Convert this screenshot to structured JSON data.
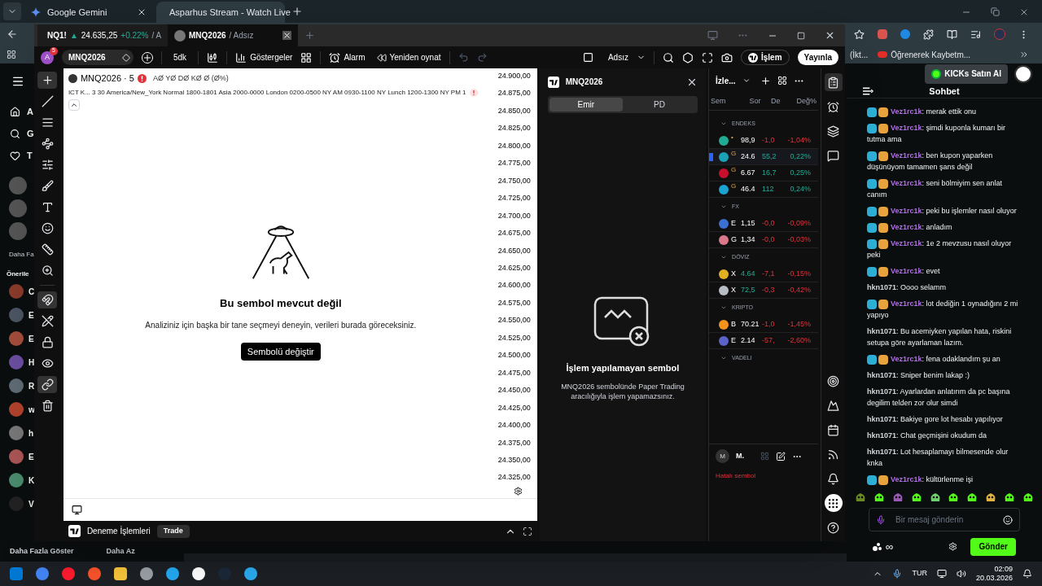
{
  "browser": {
    "tabs": [
      {
        "title": "Google Gemini",
        "selected": false
      },
      {
        "title": "Asparhus Stream - Watch Live",
        "selected": true
      }
    ],
    "bookmarks": [
      "(İkt...",
      "Öğrenerek Kaybetm..."
    ]
  },
  "site_sidebar": {
    "nav": [
      "A",
      "G",
      "T"
    ],
    "more": "Daha Fa",
    "heading": "Önerile",
    "channels": [
      "C",
      "E",
      "E",
      "H",
      "R",
      "w",
      "h",
      "E",
      "K",
      "V"
    ],
    "show_more": "Daha Fazla Göster",
    "show_less": "Daha Az"
  },
  "trading_window": {
    "tabs": [
      {
        "symbol": "NQ1!",
        "arrow": "▲",
        "price": "24.635,25",
        "change": "+0.22%",
        "layout": "/ A",
        "selected": false
      },
      {
        "symbol": "MNQ2026",
        "layout": "/ Adsız",
        "selected": true
      }
    ],
    "toolbar": {
      "avatar": "A",
      "badge": "5",
      "symbol": "MNQ2026",
      "interval": "5dk",
      "indicators": "Göstergeler",
      "alert": "Alarm",
      "replay": "Yeniden oynat",
      "layout_name": "Adsız",
      "trade": "İşlem",
      "publish": "Yayınla"
    },
    "tools": [
      {
        "kind": "crosshair",
        "selected": true
      },
      {
        "kind": "line",
        "selected": false
      },
      {
        "kind": "fib",
        "selected": false
      },
      {
        "kind": "pattern",
        "selected": false
      },
      {
        "kind": "projection",
        "selected": false
      },
      {
        "kind": "brush",
        "selected": false
      },
      {
        "kind": "text",
        "selected": false
      },
      {
        "kind": "emoji",
        "selected": false
      },
      {
        "kind": "ruler",
        "selected": false
      },
      {
        "kind": "zoom",
        "selected": false
      },
      {
        "kind": "magnet",
        "selected": true
      },
      {
        "kind": "pencil",
        "selected": false
      },
      {
        "kind": "lock",
        "selected": false
      },
      {
        "kind": "eye",
        "selected": false
      },
      {
        "kind": "link",
        "selected": true
      },
      {
        "kind": "trash",
        "selected": false
      }
    ],
    "chart": {
      "legend": "MNQ2026 · 5",
      "ohlc": "AØ YØ DØ KØ Ø (Ø%)",
      "indicator": "ICT K... 3 30 America/New_York Normal 1800-1801 Asia 2000-0000 London 0200-0500 NY AM 0930-1100 NY Lunch 1200-1300 NY PM 1",
      "price_axis": [
        "24.900,00",
        "24.875,00",
        "24.850,00",
        "24.825,00",
        "24.800,00",
        "24.775,00",
        "24.750,00",
        "24.725,00",
        "24.700,00",
        "24.675,00",
        "24.650,00",
        "24.625,00",
        "24.600,00",
        "24.575,00",
        "24.550,00",
        "24.525,00",
        "24.500,00",
        "24.475,00",
        "24.450,00",
        "24.425,00",
        "24.400,00",
        "24.375,00",
        "24.350,00",
        "24.325,00"
      ],
      "empty_title": "Bu sembol mevcut değil",
      "empty_text": "Analiziniz için başka bir tane seçmeyi deneyin, verileri burada göreceksiniz.",
      "change_button": "Sembolü değiştir"
    },
    "bottom_bar": {
      "title": "Deneme İşlemleri",
      "tab": "Trade"
    },
    "order_panel": {
      "symbol": "MNQ2026",
      "tabs": [
        {
          "label": "Emir",
          "selected": true
        },
        {
          "label": "PD",
          "selected": false
        }
      ],
      "title": "İşlem yapılamayan sembol",
      "text": "MNQ2026 sembolünde Paper Trading aracılığıyla işlem yapamazsınız."
    },
    "watchlist": {
      "title": "İzle...",
      "columns": [
        "Sem",
        "Sor",
        "De",
        "Değ%"
      ],
      "groups": [
        {
          "name": "ENDEKS",
          "items": [
            {
              "color": "#22ab94",
              "mark": "•",
              "last": "98,9",
              "change": "-1,0",
              "percent": "-1,04%",
              "up": false,
              "last_up": false,
              "selected": false
            },
            {
              "color": "#1aa3b8",
              "mark": "G",
              "last": "24.6",
              "change": "55,2",
              "percent": "0,22%",
              "up": true,
              "last_up": false,
              "selected": true
            },
            {
              "color": "#c8102e",
              "mark": "G",
              "last": "6.67",
              "change": "16,7",
              "percent": "0,25%",
              "up": true,
              "last_up": false,
              "selected": false
            },
            {
              "color": "#1aa3d0",
              "mark": "G",
              "last": "46.4",
              "change": "112",
              "percent": "0,24%",
              "up": true,
              "last_up": false,
              "selected": false
            }
          ]
        },
        {
          "name": "FX",
          "items": [
            {
              "color": "#3b6fd1",
              "name": "E",
              "last": "1,15",
              "change": "-0,0",
              "percent": "-0,09%",
              "up": false,
              "last_up": false,
              "selected": false
            },
            {
              "color": "#d9788a",
              "name": "G",
              "last": "1,34",
              "change": "-0,0",
              "percent": "-0,03%",
              "up": false,
              "last_up": false,
              "selected": false
            }
          ]
        },
        {
          "name": "DÖVIZ",
          "items": [
            {
              "color": "#e0b020",
              "name": "X",
              "last": "4.64",
              "change": "-7,1",
              "percent": "-0,15%",
              "up": false,
              "last_up": true,
              "selected": false
            },
            {
              "color": "#b8bcc4",
              "name": "X",
              "last": "72,5",
              "change": "-0,3",
              "percent": "-0,42%",
              "up": false,
              "last_up": true,
              "selected": false
            }
          ]
        },
        {
          "name": "KRIPTO",
          "items": [
            {
              "color": "#f7931a",
              "name": "B",
              "last": "70.21",
              "change": "-1,0",
              "percent": "-1,45%",
              "up": false,
              "last_up": false,
              "selected": false
            },
            {
              "color": "#5b62c8",
              "name": "E",
              "last": "2.14",
              "change": "-57,",
              "percent": "-2,60%",
              "up": false,
              "last_up": false,
              "selected": false
            }
          ]
        },
        {
          "name": "VADELI"
        }
      ],
      "details": {
        "avatar": "M",
        "symbol": "M.",
        "status": "Hatalı sembol"
      }
    },
    "right_tools": [
      {
        "kind": "list",
        "selected": true
      },
      {
        "kind": "alarm",
        "selected": false
      },
      {
        "kind": "layers",
        "selected": false
      },
      {
        "kind": "chat",
        "selected": false
      },
      {
        "kind": "target",
        "selected": false
      },
      {
        "kind": "ideas",
        "selected": false
      },
      {
        "kind": "calendar",
        "selected": false
      },
      {
        "kind": "stream",
        "selected": false
      },
      {
        "kind": "bell",
        "selected": false
      },
      {
        "kind": "apps",
        "selected": false
      },
      {
        "kind": "help",
        "selected": false
      }
    ]
  },
  "chat": {
    "buy": "KICKs Satın Al",
    "title": "Sohbet",
    "separator": ":",
    "messages": [
      {
        "badges": true,
        "user": "Vez1rc1k",
        "color": "#b06ee8",
        "text": "merak ettik onu"
      },
      {
        "badges": true,
        "user": "Vez1rc1k",
        "color": "#b06ee8",
        "text": "şimdi kuponla kumarı bir tutma ama"
      },
      {
        "badges": true,
        "user": "Vez1rc1k",
        "color": "#b06ee8",
        "text": "ben kupon yaparken düşünüyom tamamen şans değil"
      },
      {
        "badges": true,
        "user": "Vez1rc1k",
        "color": "#b06ee8",
        "text": "seni bölmiyim sen anlat canım"
      },
      {
        "badges": true,
        "user": "Vez1rc1k",
        "color": "#b06ee8",
        "text": "peki bu işlemler nasıl oluyor"
      },
      {
        "badges": true,
        "user": "Vez1rc1k",
        "color": "#b06ee8",
        "text": "anladım"
      },
      {
        "badges": true,
        "user": "Vez1rc1k",
        "color": "#b06ee8",
        "text": "1e 2 mevzusu nasıl oluyor peki"
      },
      {
        "badges": true,
        "user": "Vez1rc1k",
        "color": "#b06ee8",
        "text": "evet"
      },
      {
        "badges": false,
        "user": "hkn1071",
        "color": "#d4d7dc",
        "text": "Oooo selamm"
      },
      {
        "badges": true,
        "user": "Vez1rc1k",
        "color": "#b06ee8",
        "text": "lot dediğin 1 oynadığını 2 mi yapıyo"
      },
      {
        "badges": false,
        "user": "hkn1071",
        "color": "#d4d7dc",
        "text": "Bu acemiyken yapılan hata, riskini setupa göre ayarlaman lazım."
      },
      {
        "badges": true,
        "user": "Vez1rc1k",
        "color": "#b06ee8",
        "text": "fena odaklandım şu an"
      },
      {
        "badges": false,
        "user": "hkn1071",
        "color": "#d4d7dc",
        "text": "Sniper benim lakap :)"
      },
      {
        "badges": false,
        "user": "hkn1071",
        "color": "#d4d7dc",
        "text": "Ayarlardan anlatırım da pc başına degilim telden zor olur simdi"
      },
      {
        "badges": false,
        "user": "hkn1071",
        "color": "#d4d7dc",
        "text": "Bakiye gore lot hesabı yapılıyor"
      },
      {
        "badges": false,
        "user": "hkn1071",
        "color": "#d4d7dc",
        "text": "Chat geçmişini okudum da"
      },
      {
        "badges": false,
        "user": "hkn1071",
        "color": "#d4d7dc",
        "text": "Lot hesaplamayı bilmesende olur knka"
      },
      {
        "badges": true,
        "user": "Vez1rc1k",
        "color": "#b06ee8",
        "text": "kültürlenme işi"
      }
    ],
    "placeholder": "Bir mesaj gönderin",
    "infinity": "∞",
    "send": "Gönder"
  },
  "taskbar": {
    "language": "TUR",
    "time": "02:09",
    "date": "20.03.2026"
  }
}
